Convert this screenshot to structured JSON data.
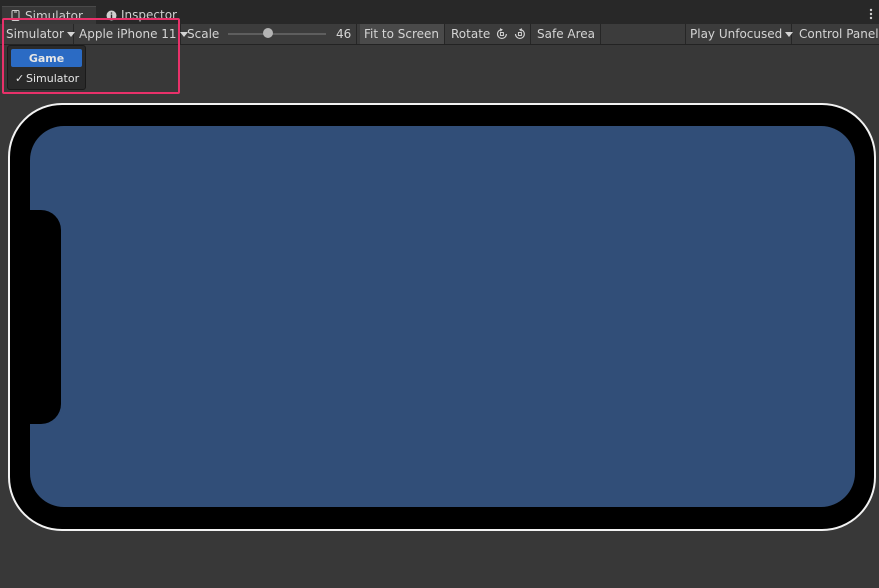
{
  "tabs": [
    {
      "label": "Simulator",
      "icon": "device-icon",
      "active": true
    },
    {
      "label": "Inspector",
      "icon": "info-icon",
      "active": false
    }
  ],
  "toolbar": {
    "view_mode": "Simulator",
    "device": "Apple iPhone 11",
    "scale_label": "Scale",
    "scale_value": "46",
    "fit_to_screen": "Fit to Screen",
    "rotate_label": "Rotate",
    "safe_area": "Safe Area",
    "play_mode": "Play Unfocused",
    "control_panel": "Control Panel"
  },
  "view_mode_menu": {
    "items": [
      {
        "label": "Game",
        "checked": false,
        "hovered": true
      },
      {
        "label": "Simulator",
        "checked": true,
        "hovered": false
      }
    ],
    "check_glyph": "✓"
  },
  "colors": {
    "screen": "#314e78",
    "highlight": "#e8316a",
    "menu_selected": "#2b6bc4"
  }
}
